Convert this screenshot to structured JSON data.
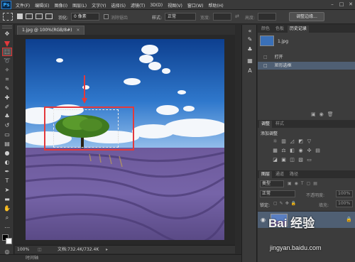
{
  "menubar": {
    "logo": "Ps",
    "items": [
      "文件(F)",
      "编辑(E)",
      "图像(I)",
      "图层(L)",
      "文字(Y)",
      "选择(S)",
      "滤镜(T)",
      "3D(D)",
      "视图(V)",
      "窗口(W)",
      "帮助(H)"
    ]
  },
  "options": {
    "feather_label": "羽化:",
    "feather_value": "0 像素",
    "antialias_label": "消除锯齿",
    "style_label": "样式:",
    "style_value": "正常",
    "width_label": "宽度:",
    "height_label": "高度:",
    "refine_edge": "调整边缘..."
  },
  "document": {
    "tab_title": "1.jpg @ 100%(RGB/8#)"
  },
  "status": {
    "zoom": "100%",
    "doc_size": "文档:732.4K/732.4K"
  },
  "timeline": {
    "label": "时间轴"
  },
  "history_panel": {
    "tabs": [
      "颜色",
      "色板",
      "历史记录"
    ],
    "snapshot": "1.jpg",
    "items": [
      "打开",
      "矩形选框"
    ]
  },
  "adjust_panel": {
    "tabs": [
      "调整",
      "样式"
    ],
    "title": "添加调整"
  },
  "layers_panel": {
    "tabs": [
      "图层",
      "通道",
      "路径"
    ],
    "kind": "类型",
    "blend": "正常",
    "opacity_label": "不透明度:",
    "opacity": "100%",
    "lock_label": "锁定:",
    "fill_label": "填充:",
    "fill": "100%",
    "layer_name": "背景"
  },
  "watermark": {
    "text": "Bai 经验",
    "url": "jingyan.baidu.com"
  }
}
